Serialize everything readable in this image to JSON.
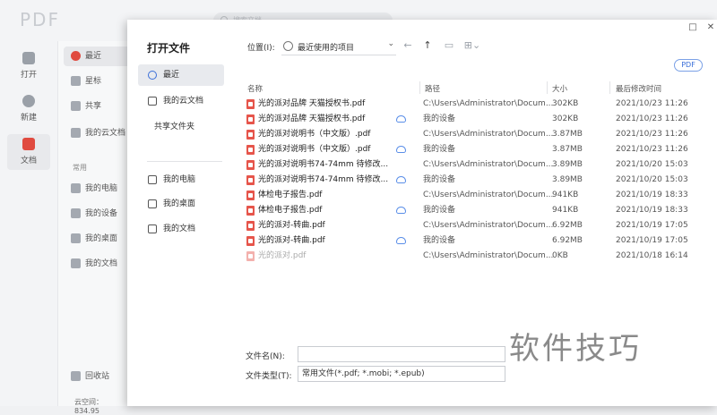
{
  "app": {
    "logo": "PDF",
    "search_placeholder": "搜索文档",
    "rail": [
      {
        "label": "打开",
        "icon": "folder-icon"
      },
      {
        "label": "新建",
        "icon": "plus-circle-icon"
      },
      {
        "label": "文档",
        "icon": "document-icon",
        "active": true
      }
    ],
    "sidebar": {
      "items": [
        {
          "label": "最近",
          "icon": "clock-icon",
          "active": true
        },
        {
          "label": "星标",
          "icon": "star-icon"
        },
        {
          "label": "共享",
          "icon": "people-icon"
        },
        {
          "label": "我的云文档",
          "icon": "cloud-icon"
        }
      ],
      "common_heading": "常用",
      "common": [
        {
          "label": "我的电脑",
          "icon": "computer-icon"
        },
        {
          "label": "我的设备",
          "icon": "device-icon"
        },
        {
          "label": "我的桌面",
          "icon": "desktop-icon"
        },
        {
          "label": "我的文档",
          "icon": "documents-icon"
        }
      ],
      "trash": "回收站",
      "space": "云空间：834.95"
    }
  },
  "dialog": {
    "title": "打开文件",
    "nav": [
      {
        "label": "最近",
        "icon": "clock-icon",
        "active": true
      },
      {
        "label": "我的云文档",
        "icon": "cloud-box-icon"
      },
      {
        "label": "共享文件夹",
        "icon": ""
      },
      {
        "label": "我的电脑",
        "icon": "monitor-icon"
      },
      {
        "label": "我的桌面",
        "icon": "desktop-icon"
      },
      {
        "label": "我的文档",
        "icon": "folder-icon"
      }
    ],
    "location_label": "位置(I):",
    "location_value": "最近使用的项目",
    "filter_badge": "PDF",
    "columns": {
      "name": "名称",
      "path": "路径",
      "size": "大小",
      "modified": "最后修改时间"
    },
    "files": [
      {
        "name": "光的派对品牌 天猫授权书.pdf",
        "cloud": false,
        "path": "C:\\Users\\Administrator\\Docum...",
        "size": "302KB",
        "modified": "2021/10/23 11:26"
      },
      {
        "name": "光的派对品牌 天猫授权书.pdf",
        "cloud": true,
        "path": "我的设备",
        "size": "302KB",
        "modified": "2021/10/23 11:26"
      },
      {
        "name": "光的派对说明书（中文版）.pdf",
        "cloud": false,
        "path": "C:\\Users\\Administrator\\Docum...",
        "size": "3.87MB",
        "modified": "2021/10/23 11:26"
      },
      {
        "name": "光的派对说明书（中文版）.pdf",
        "cloud": true,
        "path": "我的设备",
        "size": "3.87MB",
        "modified": "2021/10/23 11:26"
      },
      {
        "name": "光的派对说明书74-74mm 待修改...",
        "cloud": false,
        "path": "C:\\Users\\Administrator\\Docum...",
        "size": "3.89MB",
        "modified": "2021/10/20 15:03"
      },
      {
        "name": "光的派对说明书74-74mm 待修改...",
        "cloud": true,
        "path": "我的设备",
        "size": "3.89MB",
        "modified": "2021/10/20 15:03"
      },
      {
        "name": "体检电子报告.pdf",
        "cloud": false,
        "path": "C:\\Users\\Administrator\\Docum...",
        "size": "941KB",
        "modified": "2021/10/19 18:33"
      },
      {
        "name": "体检电子报告.pdf",
        "cloud": true,
        "path": "我的设备",
        "size": "941KB",
        "modified": "2021/10/19 18:33"
      },
      {
        "name": "光的派对-转曲.pdf",
        "cloud": false,
        "path": "C:\\Users\\Administrator\\Docum...",
        "size": "6.92MB",
        "modified": "2021/10/19 17:05"
      },
      {
        "name": "光的派对-转曲.pdf",
        "cloud": true,
        "path": "我的设备",
        "size": "6.92MB",
        "modified": "2021/10/19 17:05"
      },
      {
        "name": "光的派对.pdf",
        "cloud": false,
        "dim": true,
        "path": "C:\\Users\\Administrator\\Docum...",
        "size": "0KB",
        "modified": "2021/10/18 16:14"
      }
    ],
    "filename_label": "文件名(N):",
    "filename_value": "",
    "filetype_label": "文件类型(T):",
    "filetype_value": "常用文件(*.pdf; *.mobi; *.epub)"
  },
  "watermark": "软件技巧"
}
